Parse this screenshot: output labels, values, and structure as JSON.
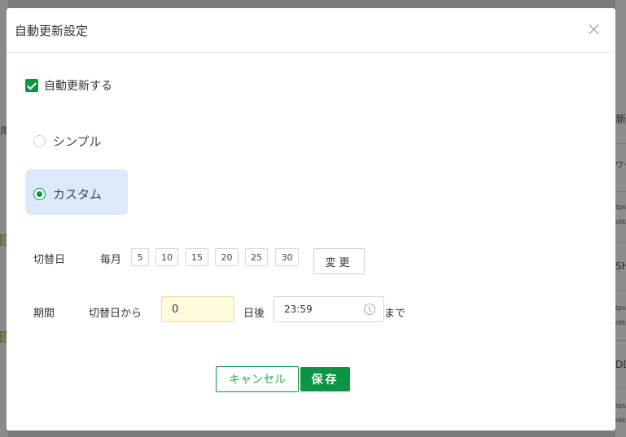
{
  "dialog": {
    "title": "自動更新設定",
    "close_label": "×"
  },
  "auto_update": {
    "label": "自動更新する",
    "checked": true
  },
  "mode": {
    "simple_label": "シンプル",
    "custom_label": "カスタム",
    "selected": "custom"
  },
  "switch_day": {
    "label": "切替日",
    "monthly_label": "毎月",
    "days": [
      "5",
      "10",
      "15",
      "20",
      "25",
      "30"
    ],
    "change_label": "変更"
  },
  "period": {
    "label": "期間",
    "from_label": "切替日から",
    "days_value": "0",
    "after_label": "日後",
    "time_value": "23:59",
    "until_label": "まで"
  },
  "footer": {
    "cancel_label": "キャンセル",
    "save_label": "保存"
  },
  "background": {
    "left_fragments": [
      "用",
      "間",
      "間"
    ],
    "right_fragments": [
      "新",
      "ワー",
      "tps",
      "otk",
      "SH",
      "tps",
      "otk",
      "DD",
      "tps",
      "otk"
    ]
  },
  "colors": {
    "accent": "#0b9444",
    "custom_highlight": "#dbe9fb",
    "input_highlight": "#fffbdc"
  }
}
